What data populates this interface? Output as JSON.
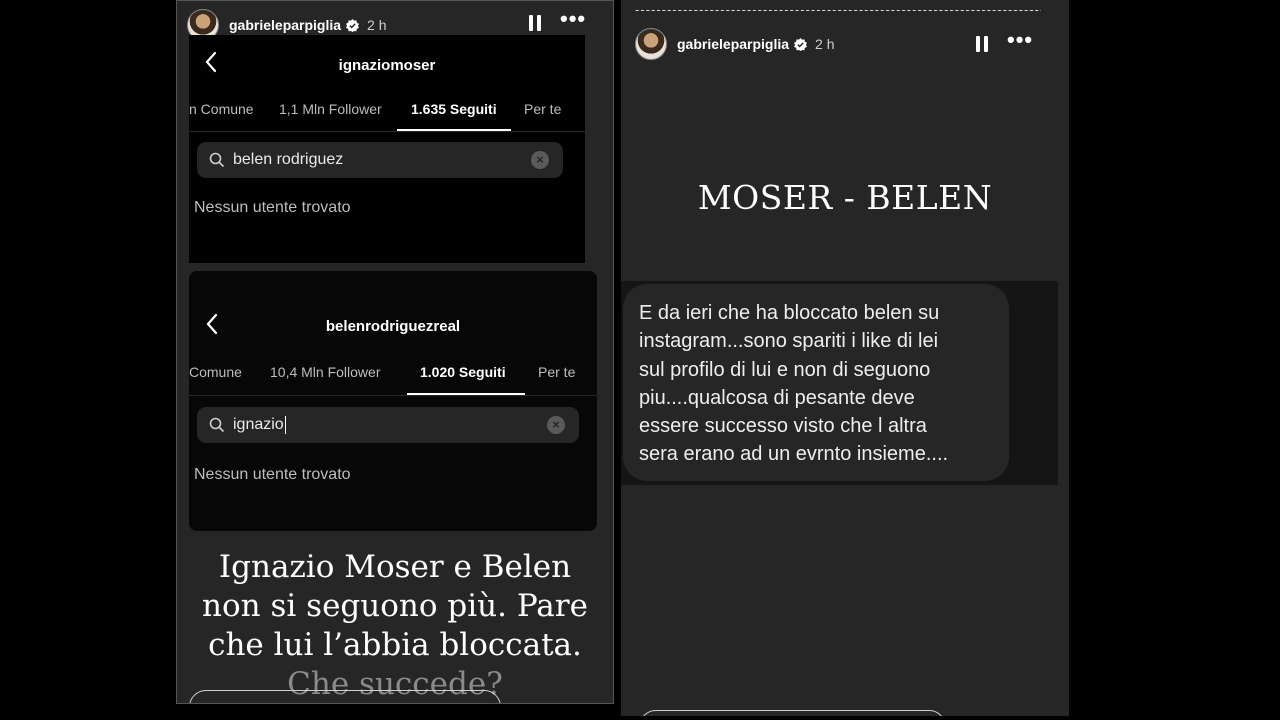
{
  "left_story": {
    "username": "gabrieleparpiglia",
    "time": "2 h",
    "shot1": {
      "profile_name": "ignaziomoser",
      "tabs": [
        "n Comune",
        "1,1 Mln Follower",
        "1.635 Seguiti",
        "Per te"
      ],
      "search_value": "belen rodriguez",
      "empty_text": "Nessun utente trovato"
    },
    "shot2": {
      "profile_name": "belenrodriguezreal",
      "tabs": [
        "Comune",
        "10,4 Mln Follower",
        "1.020 Seguiti",
        "Per te"
      ],
      "search_value": "ignazio",
      "empty_text": "Nessun utente trovato"
    },
    "caption": {
      "line1": "Ignazio Moser e Belen",
      "line2": "non si seguono più. Pare",
      "line3": "che lui l’abbia bloccata.",
      "line4": "Che succede?"
    }
  },
  "right_story": {
    "username": "gabrieleparpiglia",
    "time": "2 h",
    "dashes": "--------------------------------------------------------------------------------",
    "headline": "MOSER - BELEN",
    "message": "E da ieri che ha bloccato belen su\ninstagram...sono spariti i like di lei\nsul profilo di lui e non di seguono\npiu....qualcosa di pesante deve\nessere successo visto che l altra\nsera erano ad un evrnto insieme...."
  },
  "icons": {
    "verified": "verified-badge-icon",
    "pause": "pause-icon",
    "more": "more-options-icon",
    "back": "back-arrow-icon",
    "search": "search-icon",
    "clear": "clear-icon"
  },
  "colors": {
    "story_bg": "#262626",
    "shot_bg": "#000000",
    "message_band": "#151515",
    "bubble": "#262626"
  }
}
